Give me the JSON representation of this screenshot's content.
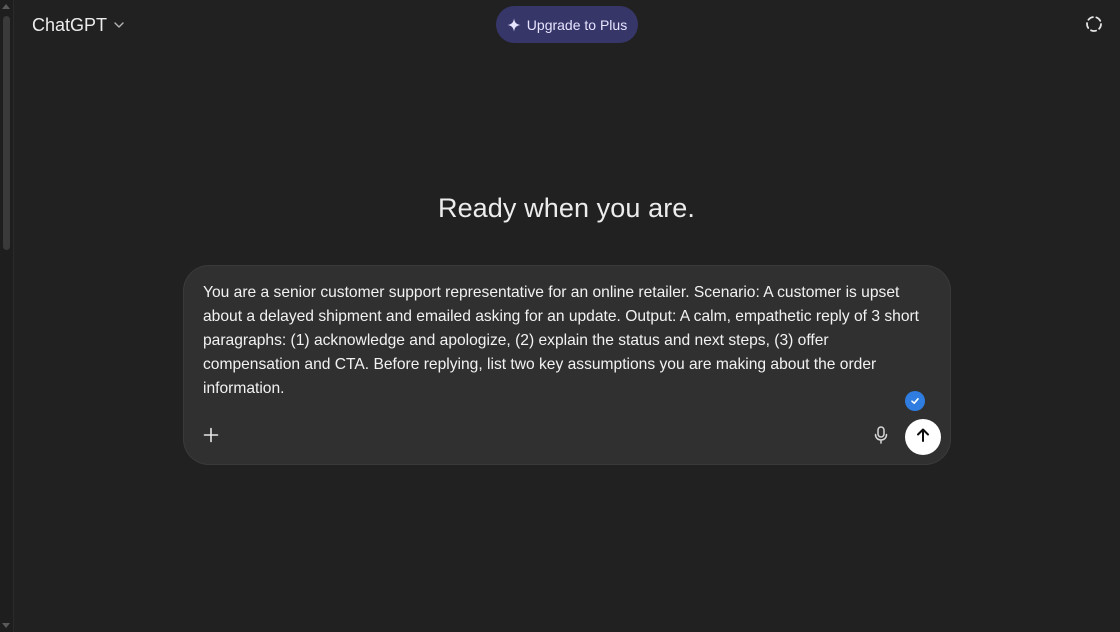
{
  "header": {
    "model_name": "ChatGPT",
    "upgrade_label": "Upgrade to Plus"
  },
  "main": {
    "headline": "Ready when you are."
  },
  "composer": {
    "prompt_text": "You are a senior customer support representative for an online retailer. Scenario: A customer is upset about a delayed shipment and emailed asking for an update. Output: A calm, empathetic reply of 3 short paragraphs: (1) acknowledge and apologize, (2) explain the status and next steps, (3) offer compensation and CTA. Before replying, list two key assumptions you are making about the order information."
  },
  "icons": {
    "model_chevron": "chevron-down-icon",
    "upgrade": "sparkle-icon",
    "temporary_chat": "dashed-circle-icon",
    "add": "plus-icon",
    "voice": "microphone-icon",
    "send": "arrow-up-icon",
    "grammar": "check-icon"
  },
  "colors": {
    "background": "#212121",
    "composer": "#303030",
    "upgrade_bg": "#373669",
    "check_badge": "#2f7de1",
    "send_bg": "#ffffff"
  }
}
